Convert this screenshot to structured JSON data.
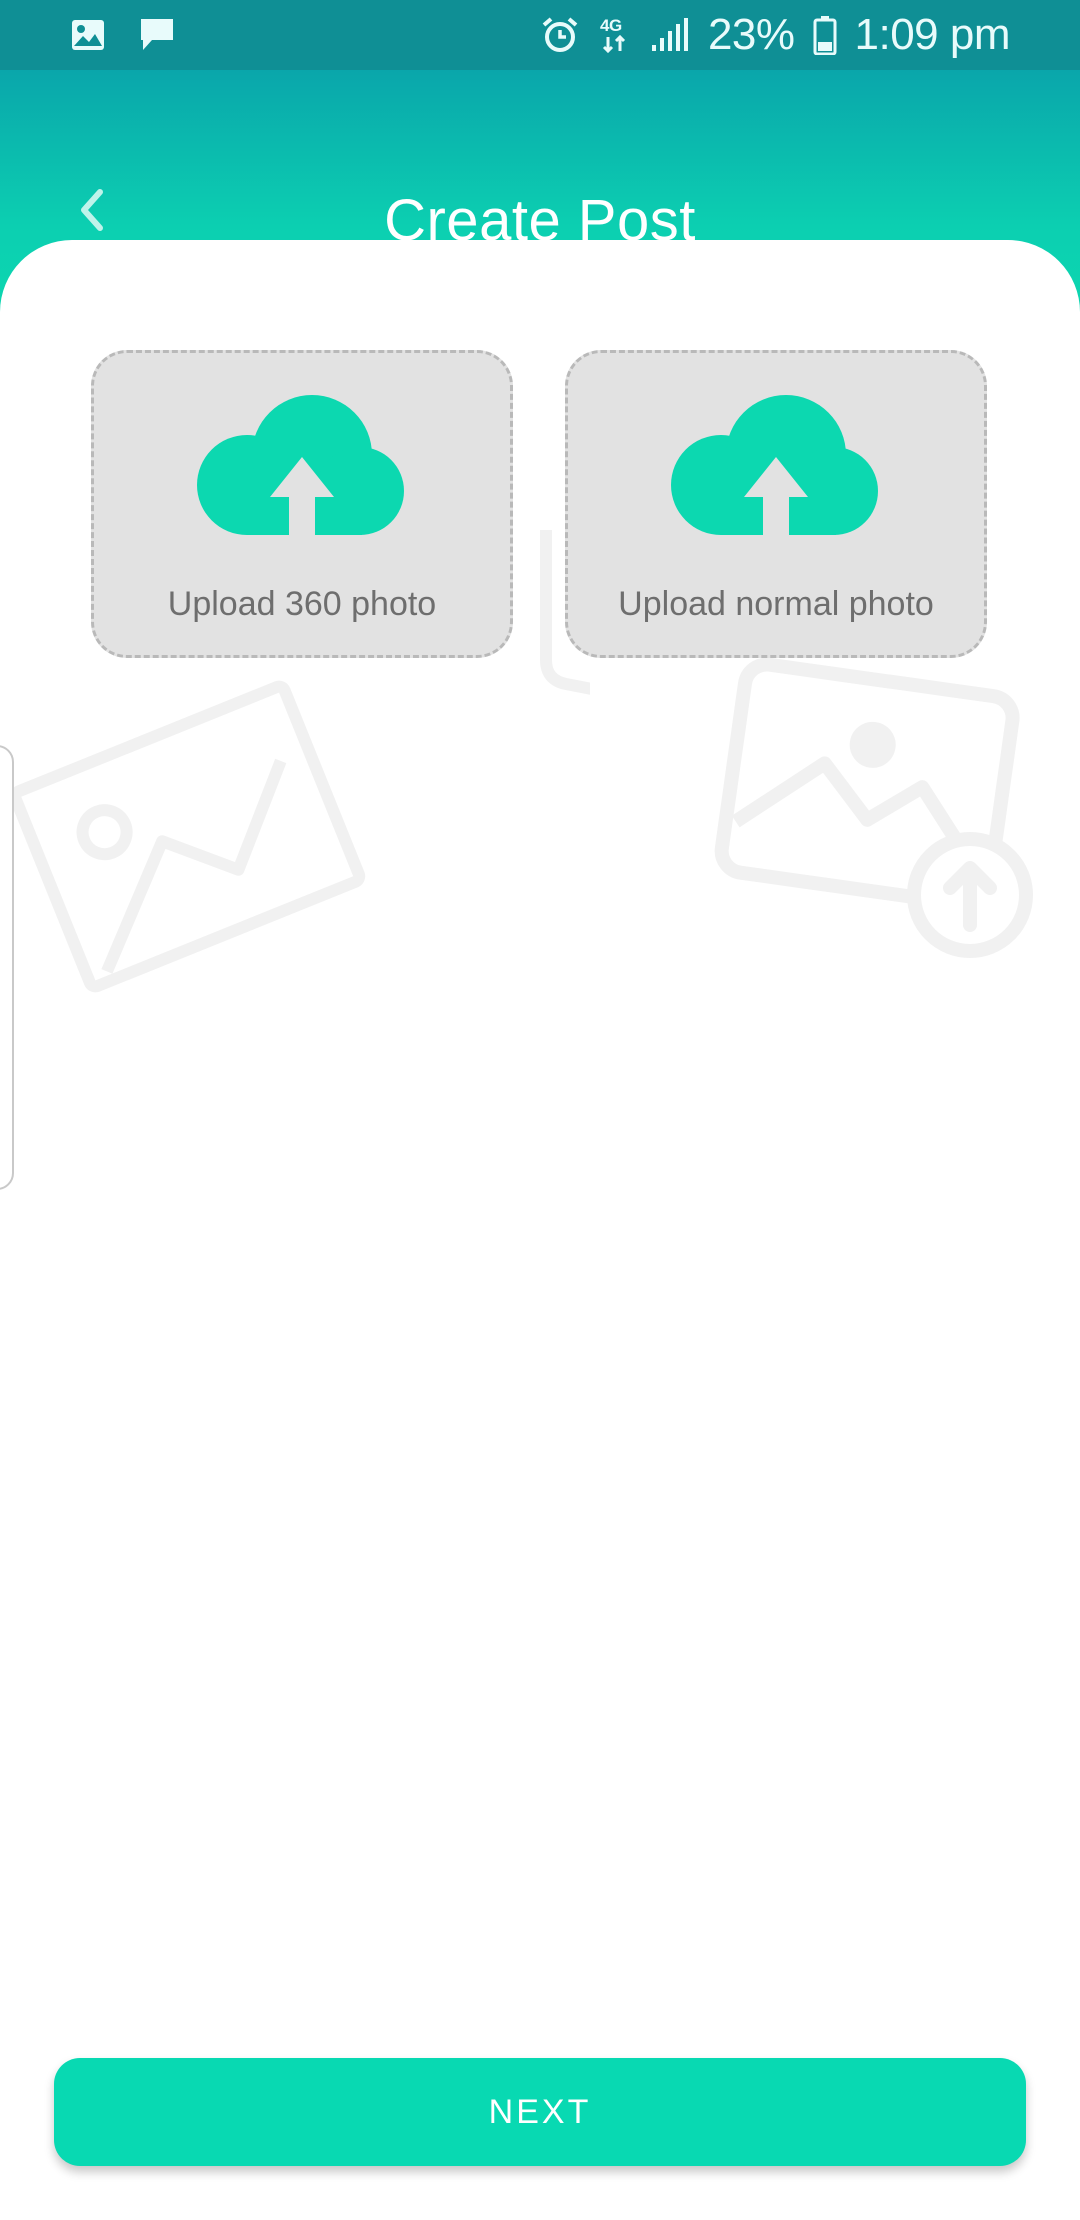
{
  "status_bar": {
    "battery_text": "23%",
    "time": "1:09 pm",
    "network": "4G",
    "left_icons": [
      "gallery-icon",
      "message-icon"
    ],
    "right_icons": [
      "alarm-icon",
      "network-4g-icon",
      "signal-icon",
      "battery-icon"
    ]
  },
  "header": {
    "title": "Create Post",
    "back_icon": "chevron-left-icon"
  },
  "uploads": [
    {
      "label": "Upload 360 photo",
      "icon": "cloud-upload-icon"
    },
    {
      "label": "Upload normal photo",
      "icon": "cloud-upload-icon"
    }
  ],
  "footer": {
    "next_label": "NEXT"
  },
  "colors": {
    "status_bar": "#0f8f95",
    "header_top": "#0aa6ab",
    "header_bottom": "#0cd8b0",
    "accent": "#08d9b2",
    "tile_bg": "#e2e2e2",
    "tile_border": "#b9b9b9",
    "label_text": "#6e6e6e"
  }
}
